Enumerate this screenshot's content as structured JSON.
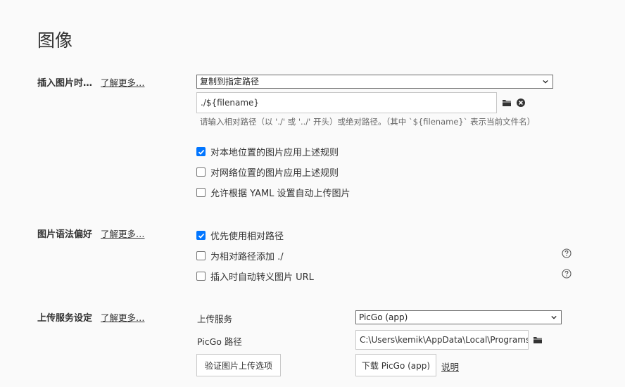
{
  "page_title": "图像",
  "sections": {
    "insert_image": {
      "label": "插入图片时…",
      "learn_more": "了解更多…",
      "action_select": "复制到指定路径",
      "path_value": "./${filename}",
      "hint": "请输入相对路径（以 './' 或 '../' 开头）或绝对路径。（其中 `${filename}` 表示当前文件名）",
      "options": [
        {
          "label": "对本地位置的图片应用上述规则",
          "checked": true
        },
        {
          "label": "对网络位置的图片应用上述规则",
          "checked": false
        },
        {
          "label": "允许根据 YAML 设置自动上传图片",
          "checked": false
        }
      ]
    },
    "syntax_pref": {
      "label": "图片语法偏好",
      "learn_more": "了解更多…",
      "options": [
        {
          "label": "优先使用相对路径",
          "checked": true,
          "help": false
        },
        {
          "label": "为相对路径添加 ./",
          "checked": false,
          "help": true
        },
        {
          "label": "插入时自动转义图片 URL",
          "checked": false,
          "help": true
        }
      ]
    },
    "upload_service": {
      "label": "上传服务设定",
      "learn_more": "了解更多…",
      "service_label": "上传服务",
      "service_value": "PicGo (app)",
      "picgo_path_label": "PicGo 路径",
      "picgo_path_value": "C:\\Users\\kemik\\AppData\\Local\\Programs\\PicGo",
      "verify_button": "验证图片上传选项",
      "download_button": "下载 PicGo (app)",
      "explain_link": "说明"
    }
  },
  "colors": {
    "checkbox_checked": "#0075ff",
    "background": "#fafafa"
  }
}
